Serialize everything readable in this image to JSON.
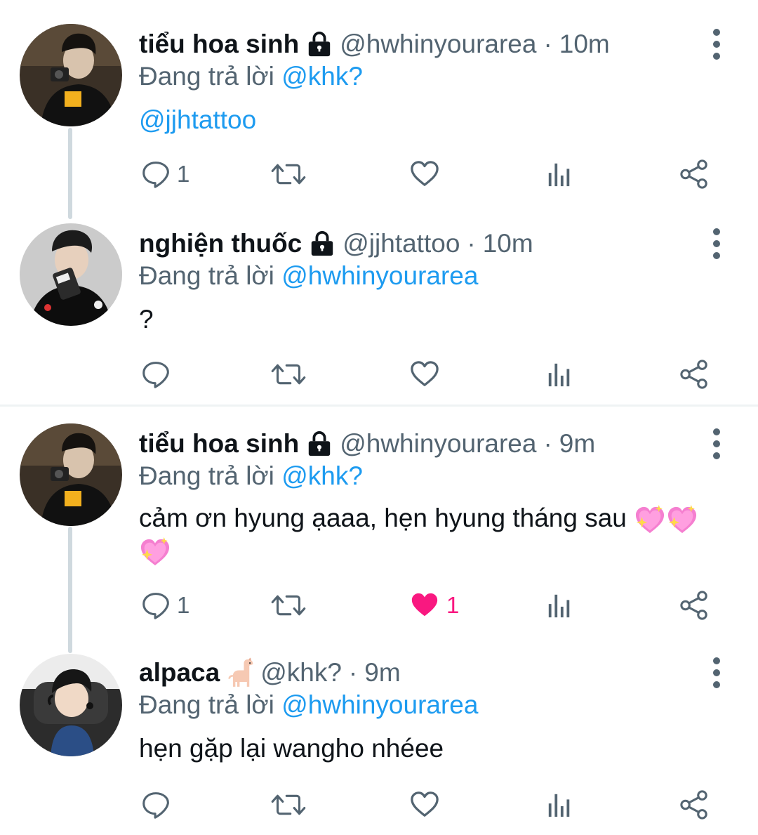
{
  "tweets": [
    {
      "name": "tiểu hoa sinh",
      "handle": "@hwhinyourarea",
      "separator": "·",
      "time": "10m",
      "reply_prefix": "Đang trả lời",
      "reply_to": "@khk?",
      "text": "@jjhtattoo",
      "reply_count": "1",
      "retweet_count": "",
      "like_count": "",
      "liked": false,
      "locked": true
    },
    {
      "name": "nghiện thuốc",
      "handle": "@jjhtattoo",
      "separator": "·",
      "time": "10m",
      "reply_prefix": "Đang trả lời",
      "reply_to": "@hwhinyourarea",
      "text": "?",
      "reply_count": "",
      "retweet_count": "",
      "like_count": "",
      "liked": false,
      "locked": true
    },
    {
      "name": "tiểu hoa sinh",
      "handle": "@hwhinyourarea",
      "separator": "·",
      "time": "9m",
      "reply_prefix": "Đang trả lời",
      "reply_to": "@khk?",
      "text": "cảm ơn hyung ạaaa, hẹn hyung tháng sau",
      "text_emojis": "sparkling-heart x3",
      "reply_count": "1",
      "retweet_count": "",
      "like_count": "1",
      "liked": true,
      "locked": true
    },
    {
      "name": "alpaca",
      "name_emoji": "llama",
      "handle": "@khk?",
      "separator": "·",
      "time": "9m",
      "reply_prefix": "Đang trả lời",
      "reply_to": "@hwhinyourarea",
      "text": "hẹn gặp lại wangho nhéee",
      "reply_count": "",
      "retweet_count": "",
      "like_count": "",
      "liked": false,
      "locked": false
    }
  ],
  "icons": [
    "lock-icon",
    "more-icon",
    "reply-icon",
    "retweet-icon",
    "like-icon",
    "views-icon",
    "share-icon"
  ],
  "colors": {
    "link": "#1d9bf0",
    "muted": "#536471",
    "like": "#f91880",
    "divider": "#eff3f4"
  }
}
